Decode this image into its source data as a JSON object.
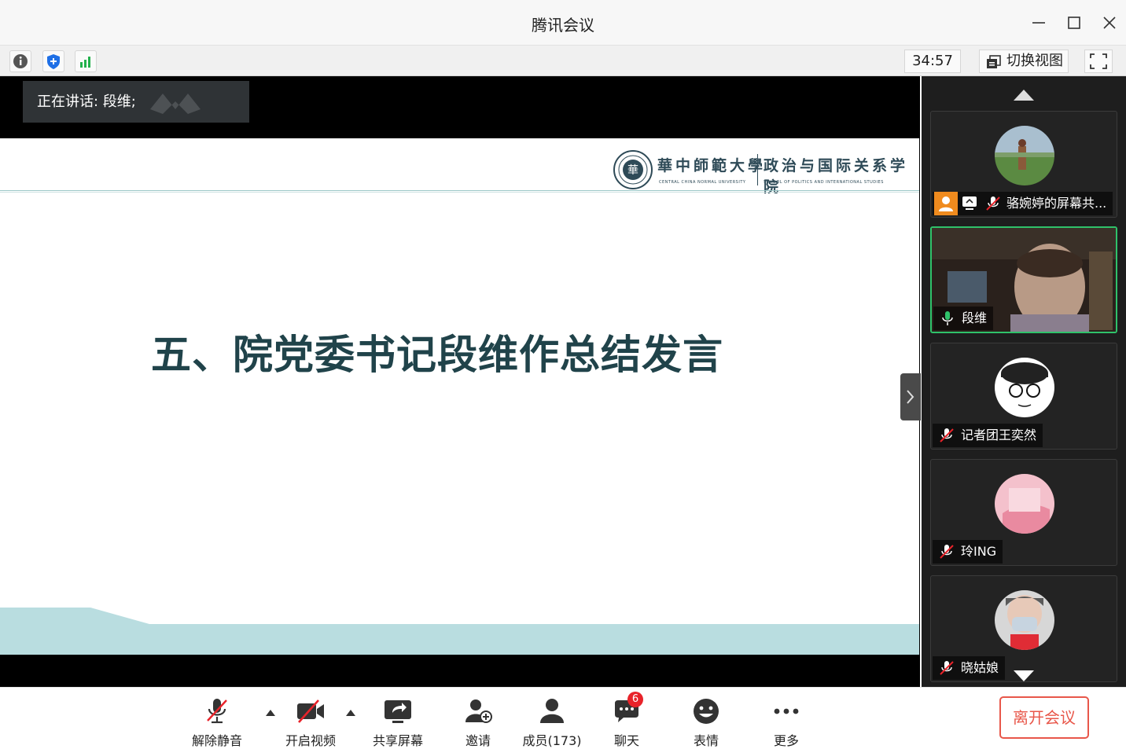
{
  "window": {
    "title": "腾讯会议"
  },
  "toolbar": {
    "timer": "34:57",
    "switch_view_label": "切换视图"
  },
  "speaker": {
    "label": "正在讲话: 段维;"
  },
  "slide": {
    "university_cn": "華中師範大學",
    "university_en": "CENTRAL CHINA NORMAL UNIVERSITY",
    "school_cn": "政治与国际关系学院",
    "school_en": "SCHOOL OF POLITICS AND INTERNATIONAL STUDIES",
    "title": "五、院党委书记段维作总结发言"
  },
  "participants": [
    {
      "name": "骆婉婷的屏幕共...",
      "mic": "muted",
      "sharing": true
    },
    {
      "name": "段维",
      "mic": "on",
      "active": true
    },
    {
      "name": "记者团王奕然",
      "mic": "muted"
    },
    {
      "name": "玲ING",
      "mic": "muted"
    },
    {
      "name": "晓姑娘",
      "mic": "muted"
    }
  ],
  "bottom": {
    "unmute": "解除静音",
    "video": "开启视频",
    "share": "共享屏幕",
    "invite": "邀请",
    "members": "成员(173)",
    "chat": "聊天",
    "chat_badge": "6",
    "reactions": "表情",
    "more": "更多",
    "leave": "离开会议"
  },
  "colors": {
    "accent_green": "#2fc26a",
    "leave_red": "#e8574a",
    "badge_red": "#e8232a",
    "slide_teal": "#20434a"
  }
}
